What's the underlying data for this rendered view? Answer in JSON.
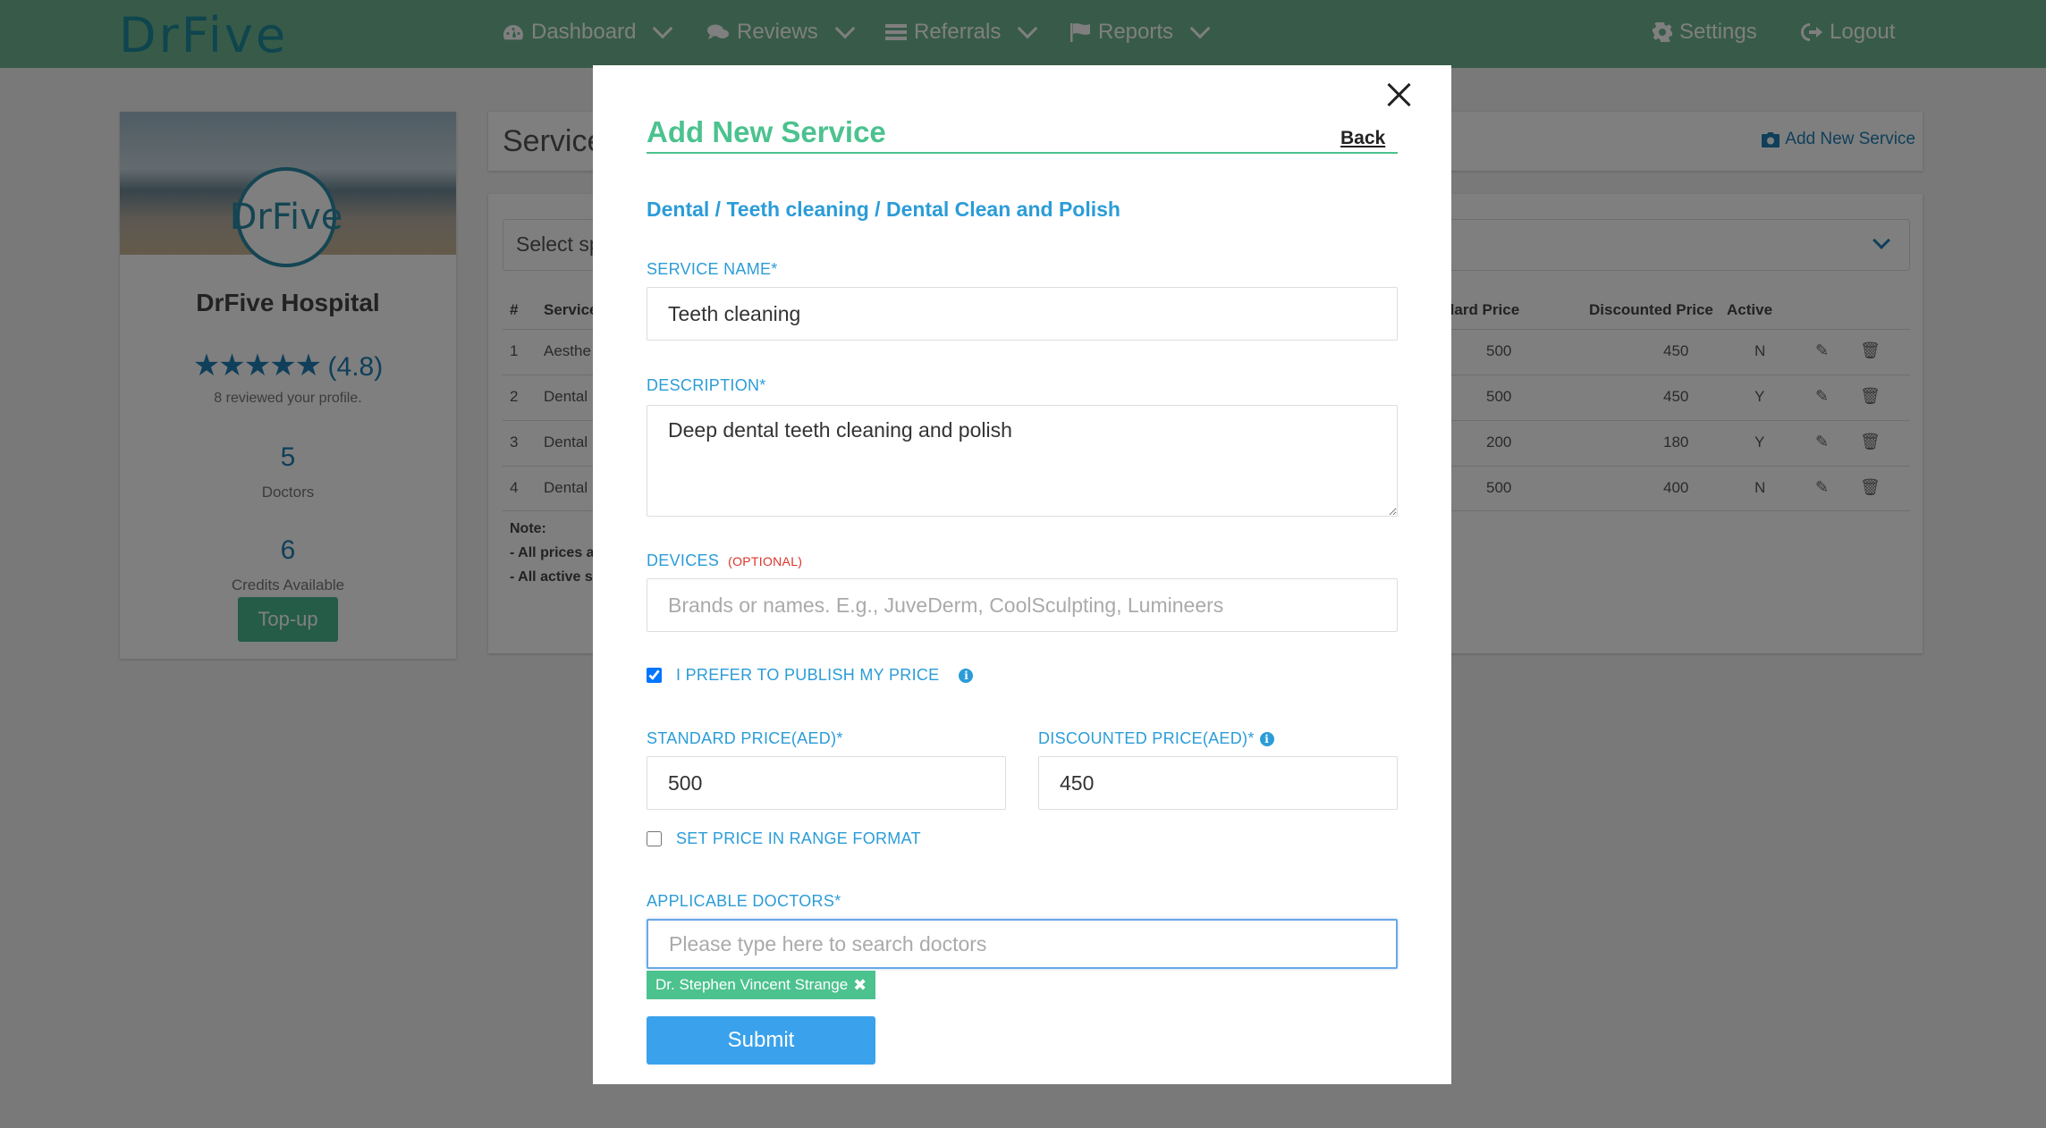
{
  "app": {
    "logo": "DrFive"
  },
  "nav": {
    "items": [
      {
        "label": "Dashboard",
        "icon": "dashboard-icon"
      },
      {
        "label": "Reviews",
        "icon": "comments-icon"
      },
      {
        "label": "Referrals",
        "icon": "list-icon"
      },
      {
        "label": "Reports",
        "icon": "flag-icon"
      }
    ],
    "settings": "Settings",
    "logout": "Logout"
  },
  "profile": {
    "avatar_text": "DrFive",
    "name": "DrFive Hospital",
    "stars": "★★★★★",
    "rating": "(4.8)",
    "reviewed": "8 reviewed your profile.",
    "doctors_count": "5",
    "doctors_label": "Doctors",
    "credits_count": "6",
    "credits_label": "Credits Available",
    "topup": "Top-up"
  },
  "services": {
    "title": "Service",
    "add_link": "Add New Service",
    "select_text": "Select sp",
    "headers": {
      "num": "#",
      "service": "Service",
      "standard": "dard Price",
      "discounted": "Discounted Price",
      "active": "Active"
    },
    "rows": [
      {
        "num": "1",
        "service": "Aesthe",
        "standard": "500",
        "discounted": "450",
        "active": "N"
      },
      {
        "num": "2",
        "service": "Dental",
        "standard": "500",
        "discounted": "450",
        "active": "Y"
      },
      {
        "num": "3",
        "service": "Dental",
        "standard": "200",
        "discounted": "180",
        "active": "Y"
      },
      {
        "num": "4",
        "service": "Dental",
        "standard": "500",
        "discounted": "400",
        "active": "N"
      }
    ],
    "note_title": "Note:",
    "note_1": "- All prices a",
    "note_2": "- All active s"
  },
  "modal": {
    "title": "Add New Service",
    "back": "Back",
    "breadcrumb": "Dental / Teeth cleaning / Dental Clean and Polish",
    "service_name_label": "SERVICE NAME*",
    "service_name_value": "Teeth cleaning",
    "description_label": "DESCRIPTION*",
    "description_value": "Deep dental teeth cleaning and polish",
    "devices_label": "DEVICES",
    "devices_optional": "(OPTIONAL)",
    "devices_placeholder": "Brands or names. E.g., JuveDerm, CoolSculpting, Lumineers",
    "publish_label": "I PREFER TO PUBLISH MY PRICE",
    "publish_checked": true,
    "standard_price_label": "STANDARD PRICE(AED)*",
    "standard_price_value": "500",
    "discounted_price_label": "DISCOUNTED PRICE(AED)*",
    "discounted_price_value": "450",
    "range_label": "SET PRICE IN RANGE FORMAT",
    "range_checked": false,
    "doctors_label": "APPLICABLE DOCTORS*",
    "doctors_placeholder": "Please type here to search doctors",
    "doctor_tag": "Dr. Stephen Vincent Strange",
    "tag_remove": "✖",
    "submit": "Submit"
  },
  "colors": {
    "navbar": "#6fb791",
    "accent_green": "#4cc28f",
    "accent_blue": "#2b9cd8",
    "submit_blue": "#3aa2ec",
    "optional_red": "#d9342b"
  }
}
